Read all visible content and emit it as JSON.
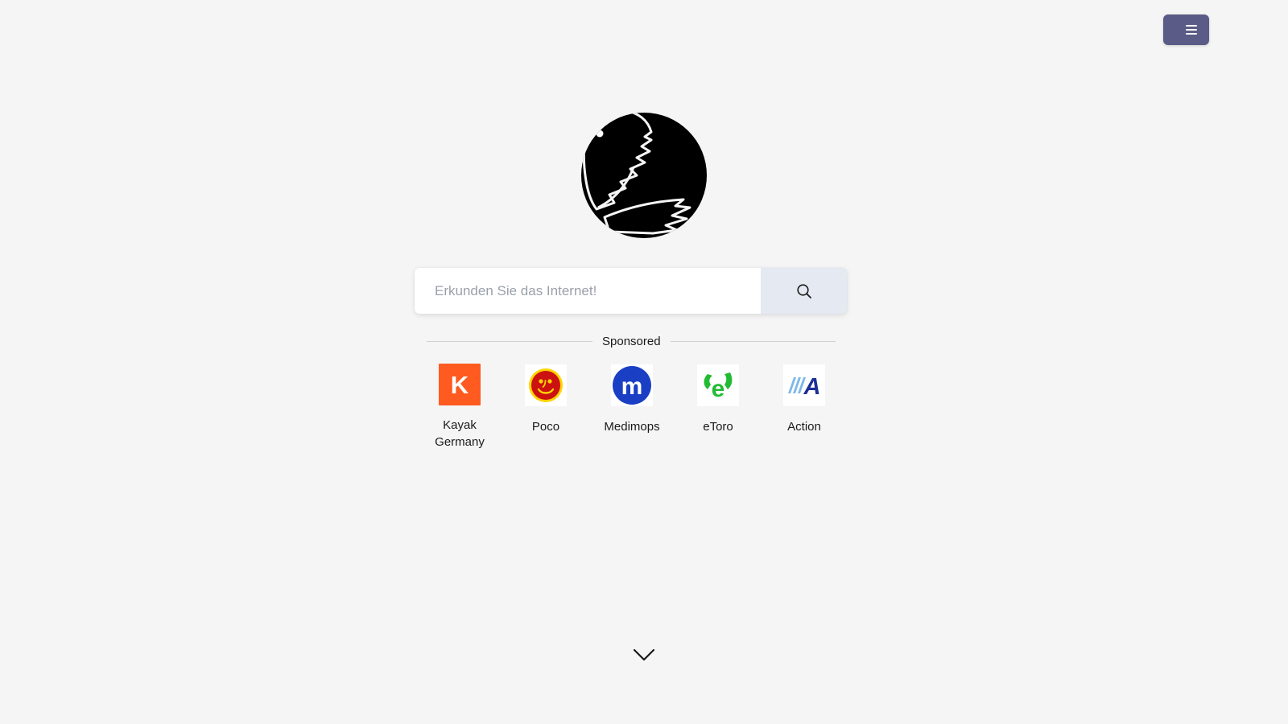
{
  "page": {
    "background_color": "#f5f5f5"
  },
  "header": {
    "menu_button": {
      "name": "menu-button",
      "icon": "hamburger-icon",
      "label": "",
      "background_color": "#5b5b87",
      "bar_color": "#ffffff"
    }
  },
  "logo": {
    "icon": "bird-silhouette-logo",
    "alt": "Search engine bird logo",
    "color": "#000000"
  },
  "search": {
    "placeholder": "Erkunden Sie das Internet!",
    "value": "",
    "focused": true,
    "submit_icon": "search-icon",
    "field_background": "#ffffff",
    "button_background": "#e4e9f2"
  },
  "sponsored": {
    "label": "Sponsored",
    "divider_color": "#cfcfcf",
    "tiles": [
      {
        "label": "Kayak Germany",
        "icon": "kayak-logo",
        "brand_color": "#ff5a1f",
        "mark": "K"
      },
      {
        "label": "Poco",
        "icon": "poco-logo",
        "brand_color": "#cc1111",
        "accent_color": "#ffd400",
        "mark": "smiley"
      },
      {
        "label": "Medimops",
        "icon": "medimops-logo",
        "brand_color": "#1a3fc4",
        "mark": "m"
      },
      {
        "label": "eToro",
        "icon": "etoro-logo",
        "brand_color": "#22bb33",
        "mark": "e"
      },
      {
        "label": "Action",
        "icon": "action-logo",
        "brand_color": "#1c2f96",
        "accent_color": "#7db8e8",
        "mark": "A"
      }
    ]
  },
  "footer": {
    "scroll_hint_icon": "chevron-down-icon",
    "scroll_hint_color": "#1a1a1a"
  }
}
